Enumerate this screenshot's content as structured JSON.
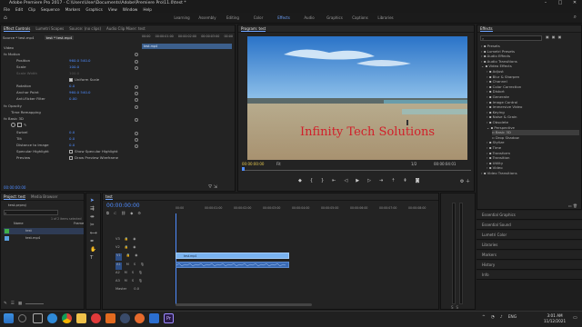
{
  "window": {
    "title": "Adobe Premiere Pro 2017 - C:\\Users\\User\\Documents\\Adobe\\Premiere Pro\\11.0\\test *"
  },
  "menu": [
    "File",
    "Edit",
    "Clip",
    "Sequence",
    "Markers",
    "Graphics",
    "View",
    "Window",
    "Help"
  ],
  "workspaces": {
    "items": [
      "Learning",
      "Assembly",
      "Editing",
      "Color",
      "Effects",
      "Audio",
      "Graphics",
      "Captions",
      "Libraries"
    ],
    "active": "Effects"
  },
  "effect_controls": {
    "tabs": [
      "Effect Controls",
      "Lumetri Scopes",
      "Source: (no clips)",
      "Audio Clip Mixer: test"
    ],
    "source": "Source * test.mp4",
    "clip": "test * test.mp4",
    "ruler": [
      "00:00",
      "00:00:01:00",
      "00:00:02:00",
      "00:00:03:00",
      "00:00"
    ],
    "clip_bar": "test.mp4",
    "video_label": "Video",
    "rows": [
      {
        "label": "fx  Motion",
        "value": ""
      },
      {
        "label": "Position",
        "value": "960.0    540.0"
      },
      {
        "label": "Scale",
        "value": "100.0"
      },
      {
        "label": "Scale Width",
        "value": "100.0"
      },
      {
        "label": "",
        "value": "Uniform Scale"
      },
      {
        "label": "Rotation",
        "value": "0.0"
      },
      {
        "label": "Anchor Point",
        "value": "960.0    540.0"
      },
      {
        "label": "Anti-flicker Filter",
        "value": "0.00"
      },
      {
        "label": "fx  Opacity",
        "value": ""
      },
      {
        "label": "Time Remapping",
        "value": ""
      },
      {
        "label": "fx  Basic 3D",
        "value": ""
      },
      {
        "label": "Swivel",
        "value": "0.0"
      },
      {
        "label": "Tilt",
        "value": "0.0"
      },
      {
        "label": "Distance to Image",
        "value": "0.0"
      },
      {
        "label": "Specular Highlight",
        "value": "Show Specular Highlight"
      },
      {
        "label": "Preview",
        "value": "Draw Preview Wireframe"
      }
    ],
    "timecode": "00:00:00:00"
  },
  "program": {
    "title": "Program: test",
    "watermark": "Infinity Tech Solutions",
    "timecode": "00:00:00:00",
    "fit": "Fit",
    "res": "1/2",
    "duration": "00:00:04:01"
  },
  "effects": {
    "title": "Effects",
    "tree": [
      {
        "label": "Presets",
        "indent": 0
      },
      {
        "label": "Lumetri Presets",
        "indent": 0
      },
      {
        "label": "Audio Effects",
        "indent": 0
      },
      {
        "label": "Audio Transitions",
        "indent": 0
      },
      {
        "label": "Video Effects",
        "indent": 0
      },
      {
        "label": "Adjust",
        "indent": 1
      },
      {
        "label": "Blur & Sharpen",
        "indent": 1
      },
      {
        "label": "Channel",
        "indent": 1
      },
      {
        "label": "Color Correction",
        "indent": 1
      },
      {
        "label": "Distort",
        "indent": 1
      },
      {
        "label": "Generate",
        "indent": 1
      },
      {
        "label": "Image Control",
        "indent": 1
      },
      {
        "label": "Immersive Video",
        "indent": 1
      },
      {
        "label": "Keying",
        "indent": 1
      },
      {
        "label": "Noise & Grain",
        "indent": 1
      },
      {
        "label": "Obsolete",
        "indent": 1
      },
      {
        "label": "Perspective",
        "indent": 1
      },
      {
        "label": "Basic 3D",
        "indent": 2,
        "selected": true
      },
      {
        "label": "Drop Shadow",
        "indent": 2
      },
      {
        "label": "Stylize",
        "indent": 1
      },
      {
        "label": "Time",
        "indent": 1
      },
      {
        "label": "Transform",
        "indent": 1
      },
      {
        "label": "Transition",
        "indent": 1
      },
      {
        "label": "Utility",
        "indent": 1
      },
      {
        "label": "Video",
        "indent": 1
      },
      {
        "label": "Video Transitions",
        "indent": 0
      }
    ],
    "stacks": [
      "Essential Graphics",
      "Essential Sound",
      "Lumetri Color",
      "Libraries",
      "Markers",
      "History",
      "Info"
    ]
  },
  "project": {
    "tabs": [
      "Project: test",
      "Media Browser"
    ],
    "name": "test.prproj",
    "items_count": "1 of 2 items selected",
    "col_name": "Name",
    "col_rate": "Frame",
    "items": [
      {
        "name": "test",
        "rate": "25.00 fps",
        "color": "#3fae4a"
      },
      {
        "name": "test.mp4",
        "rate": "25.00 fps",
        "color": "#5aa0e0"
      }
    ]
  },
  "timeline": {
    "tab": "test",
    "timecode": "00:00:00:00",
    "ruler": [
      "00:00",
      "00:00:01:00",
      "00:00:02:00",
      "00:00:03:00",
      "00:00:04:00",
      "00:00:05:00",
      "00:00:06:00",
      "00:00:07:00",
      "00:00:08:00",
      "00:00"
    ],
    "tracks": [
      "V3",
      "V2",
      "V1",
      "A1",
      "A2",
      "A3"
    ],
    "master": "Master",
    "master_val": "0.0",
    "clip": "test.mp4"
  },
  "taskbar": {
    "time": "3:01 AM",
    "date": "11/12/2021",
    "lang": "ENG"
  },
  "colors": {
    "accent": "#6fa4ff",
    "bg": "#1d1d1d",
    "panel": "#232323",
    "clip_video": "#7ab3f0",
    "clip_audio": "#3a6bb6",
    "playhead": "#4f8cff"
  }
}
